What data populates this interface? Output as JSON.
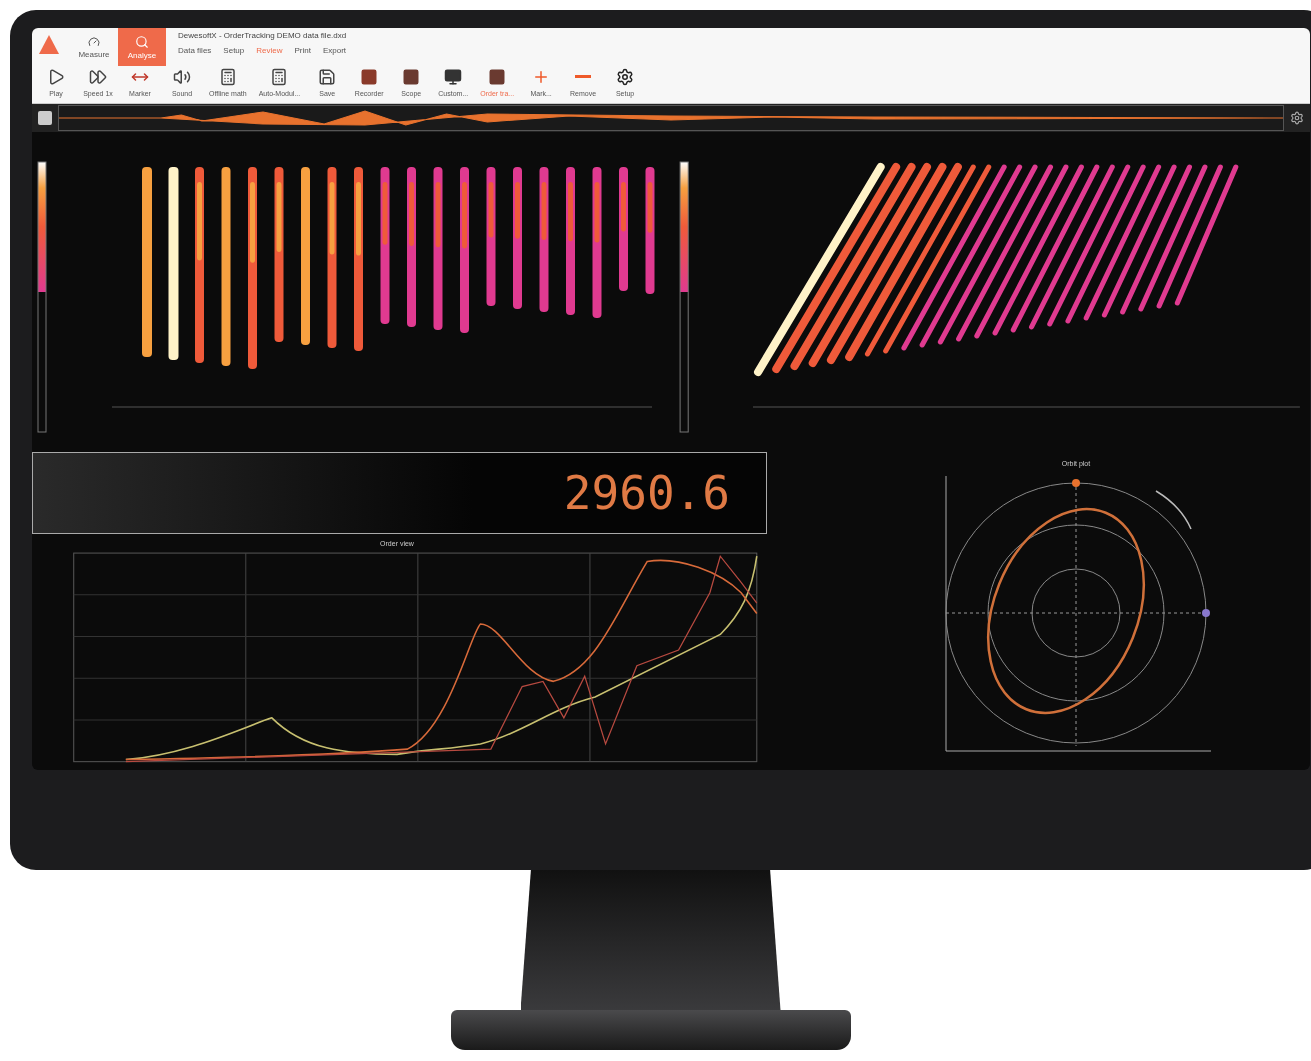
{
  "window": {
    "title": "DewesoftX - OrderTracking DEMO data file.dxd"
  },
  "modes": [
    {
      "label": "Measure",
      "selected": false
    },
    {
      "label": "Analyse",
      "selected": true
    }
  ],
  "menu_tabs": [
    {
      "label": "Data files",
      "selected": false
    },
    {
      "label": "Setup",
      "selected": false
    },
    {
      "label": "Review",
      "selected": true
    },
    {
      "label": "Print",
      "selected": false
    },
    {
      "label": "Export",
      "selected": false
    }
  ],
  "toolbar": [
    {
      "kind": "play",
      "label": "Play",
      "selected": false
    },
    {
      "kind": "speed",
      "label": "Speed 1x",
      "selected": false
    },
    {
      "kind": "marker",
      "label": "Marker",
      "selected": false
    },
    {
      "kind": "sound",
      "label": "Sound",
      "selected": false
    },
    {
      "kind": "math",
      "label": "Offline math",
      "selected": false
    },
    {
      "kind": "auto",
      "label": "Auto-Modul...",
      "selected": false
    },
    {
      "kind": "save",
      "label": "Save",
      "selected": false
    },
    {
      "kind": "recorder",
      "label": "Recorder",
      "selected": false
    },
    {
      "kind": "scope",
      "label": "Scope",
      "selected": false
    },
    {
      "kind": "custom",
      "label": "Custom...",
      "selected": false
    },
    {
      "kind": "order",
      "label": "Order tra...",
      "selected": true
    },
    {
      "kind": "add",
      "label": "Mark...",
      "selected": false
    },
    {
      "kind": "remove",
      "label": "Remove",
      "selected": false
    },
    {
      "kind": "setup",
      "label": "Setup",
      "selected": false
    }
  ],
  "digital_meter": {
    "value": "2960.6"
  },
  "order_view": {
    "title": "Order view"
  },
  "orbit_plot": {
    "title": "Orbit plot"
  }
}
